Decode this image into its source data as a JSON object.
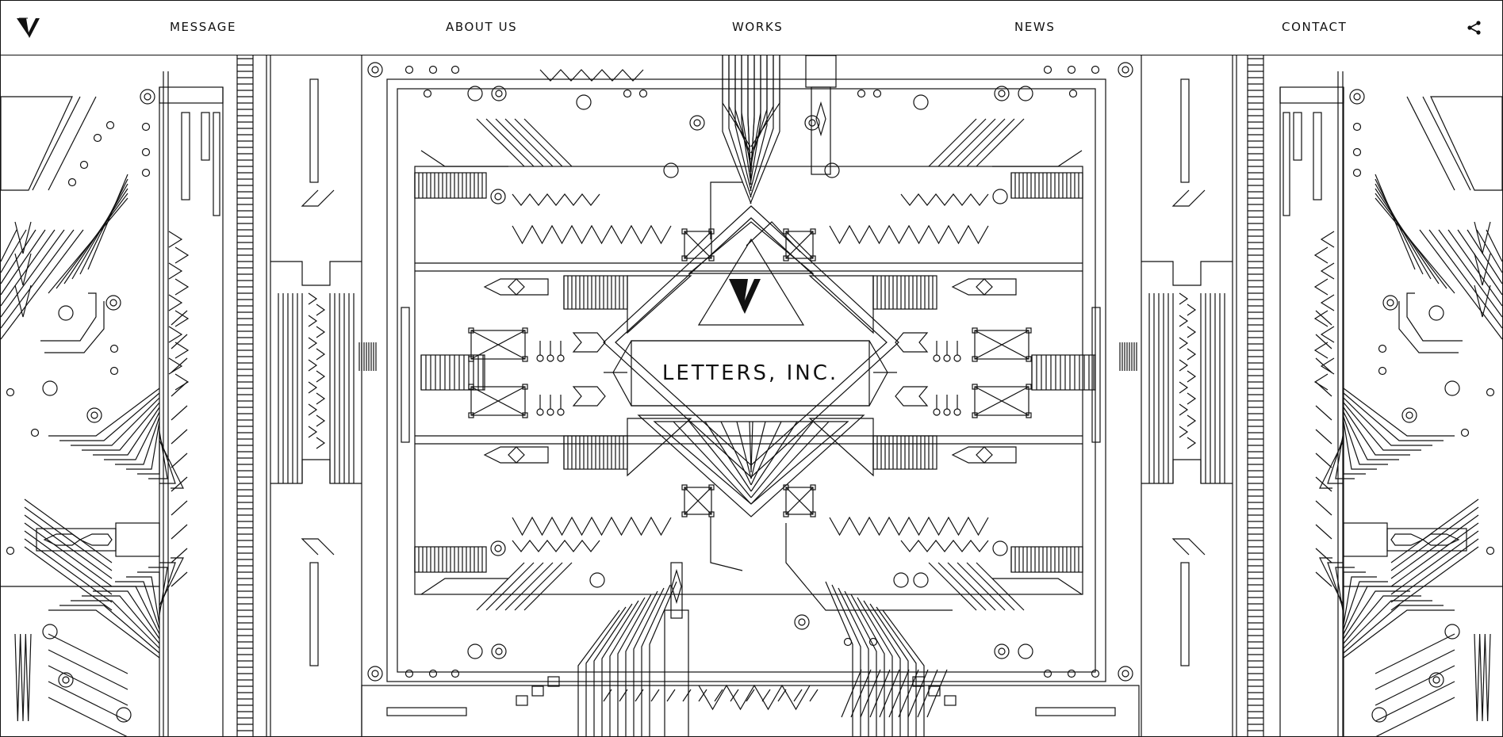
{
  "header": {
    "logo_icon": "v-monogram-icon",
    "nav": [
      {
        "label": "MESSAGE"
      },
      {
        "label": "ABOUT US"
      },
      {
        "label": "WORKS"
      },
      {
        "label": "NEWS"
      },
      {
        "label": "CONTACT"
      }
    ],
    "share_icon": "share-icon"
  },
  "hero": {
    "title": "LETTERS, INC.",
    "emblem_icon": "v-monogram-icon"
  },
  "colors": {
    "line": "#111111",
    "background": "#ffffff"
  }
}
